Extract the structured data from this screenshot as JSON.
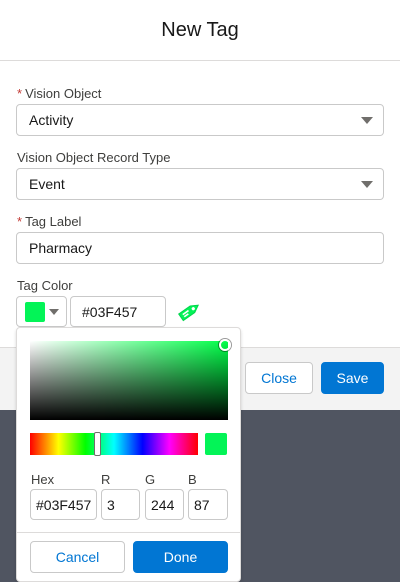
{
  "modal": {
    "title": "New Tag"
  },
  "fields": {
    "vision_object": {
      "label": "Vision Object",
      "required_mark": "*",
      "value": "Activity"
    },
    "record_type": {
      "label": "Vision Object Record Type",
      "value": "Event"
    },
    "tag_label": {
      "label": "Tag Label",
      "required_mark": "*",
      "value": "Pharmacy"
    },
    "tag_color": {
      "label": "Tag Color",
      "hex_value": "#03F457"
    }
  },
  "footer": {
    "close_label": "Close",
    "save_label": "Save"
  },
  "picker": {
    "hex_label": "Hex",
    "r_label": "R",
    "g_label": "G",
    "b_label": "B",
    "hex_value": "#03F457",
    "r_value": "3",
    "g_value": "244",
    "b_value": "87",
    "cancel_label": "Cancel",
    "done_label": "Done"
  },
  "colors": {
    "selected": "#03F457",
    "brand": "#0176D3",
    "required": "#C23934"
  },
  "icons": {
    "tag": "tag-icon",
    "dropdown": "chevron-down-icon"
  }
}
